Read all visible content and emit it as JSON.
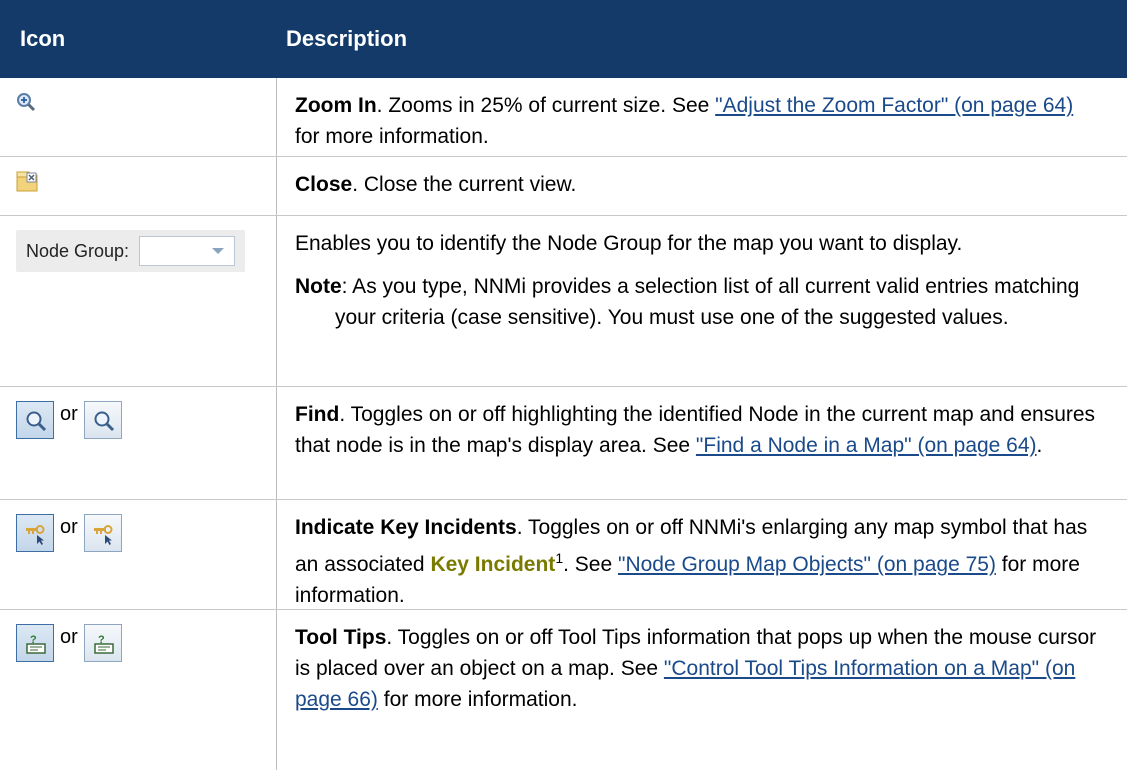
{
  "header": {
    "col_icon": "Icon",
    "col_description": "Description"
  },
  "rows": [
    {
      "icon": "zoom-in-icon",
      "bold": "Zoom In",
      "text1": ". Zooms in 25% of current size. See ",
      "link": "\"Adjust the Zoom Factor\" (on page 64)",
      "text2": " for more information."
    },
    {
      "icon": "close-view-icon",
      "bold": "Close",
      "text1": ". Close the current view."
    },
    {
      "icon": "node-group-selector",
      "icon_label": "Node Group:",
      "desc": "Enables you to identify the Node Group for the map you want to display.",
      "note_bold": "Note",
      "note_text": ": As you type, NNMi provides a selection list of all current valid entries matching your criteria (case sensitive). You must use one of the suggested values."
    },
    {
      "icon": "find-icon",
      "or": "or",
      "bold": "Find",
      "text1": ". Toggles on or off highlighting the identified Node in the current map and ensures that node is in the map's display area. See ",
      "link": "\"Find a Node in a Map\" (on page 64)",
      "text2": "."
    },
    {
      "icon": "key-incident-icon",
      "or": "or",
      "bold": "Indicate Key Incidents",
      "text1": ". Toggles on or off NNMi's enlarging any map symbol that has an associated ",
      "term": "Key Incident",
      "sup": "1",
      "text2": ". See ",
      "link": "\"Node Group Map Objects\" (on page 75)",
      "text3": " for more information."
    },
    {
      "icon": "tool-tips-icon",
      "or": "or",
      "bold": "Tool Tips",
      "text1": ". Toggles on or off Tool Tips information that pops up when the mouse cursor is placed over an object on a map. See ",
      "link": "\"Control Tool Tips Information on a Map\" (on page 66)",
      "text2": " for more information."
    }
  ]
}
